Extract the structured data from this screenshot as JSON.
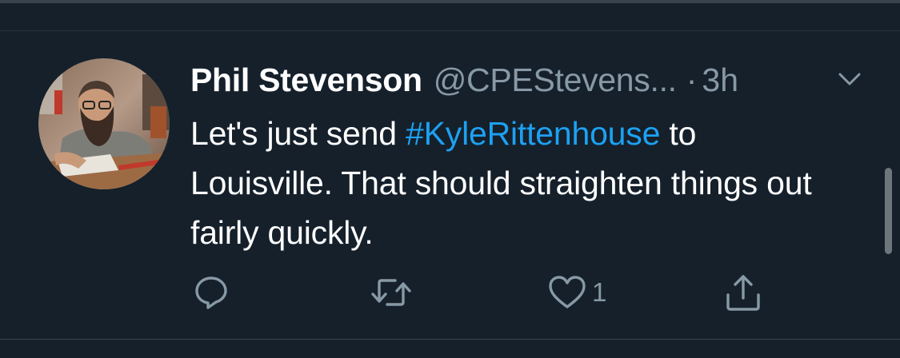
{
  "tweet": {
    "author": {
      "display_name": "Phil Stevenson",
      "handle": "@CPEStevens..."
    },
    "separator": "·",
    "time": "3h",
    "text": {
      "before": "Let's just send ",
      "hashtag": "#KyleRittenhouse",
      "after": " to Louisville. That should straighten things out fairly quickly."
    },
    "actions": {
      "reply_icon": "reply-icon",
      "retweet_icon": "retweet-icon",
      "like_icon": "heart-icon",
      "like_count": "1",
      "share_icon": "share-icon"
    }
  },
  "colors": {
    "background": "#15202b",
    "text": "#ffffff",
    "secondary": "#8899a6",
    "link": "#1da1f2"
  }
}
